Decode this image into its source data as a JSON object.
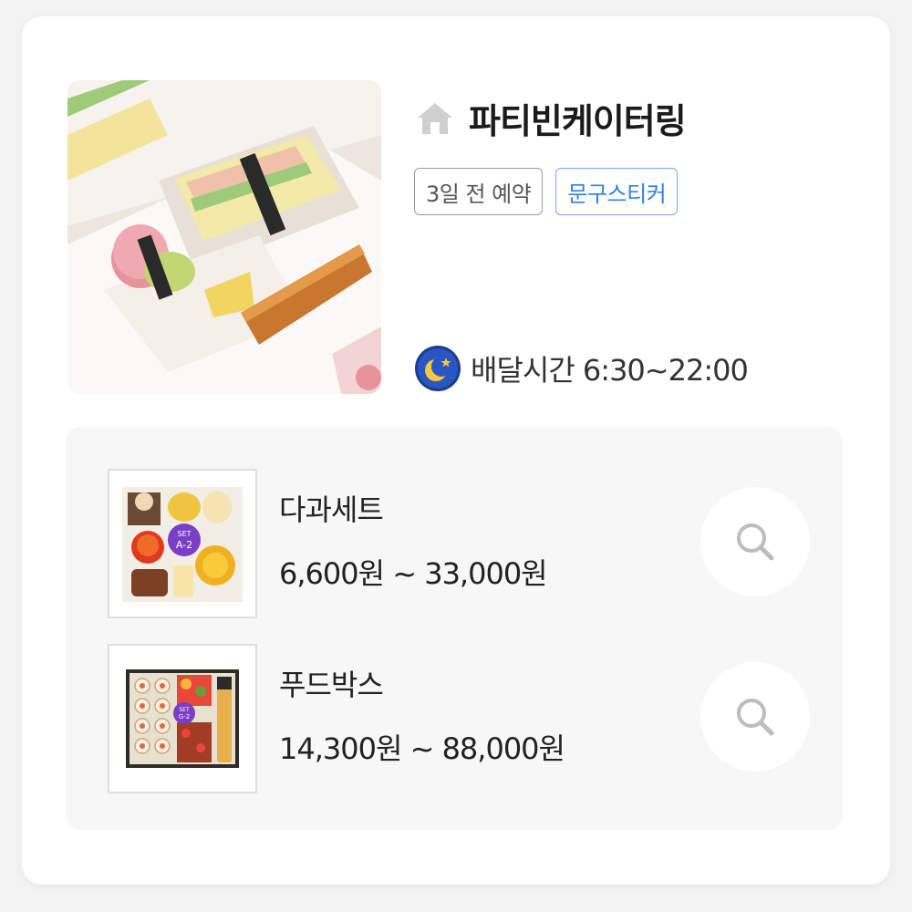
{
  "store": {
    "name": "파티빈케이터링",
    "home_icon": "home-icon"
  },
  "tags": [
    {
      "label": "3일 전 예약",
      "style": "gray"
    },
    {
      "label": "문구스티커",
      "style": "blue"
    }
  ],
  "delivery": {
    "icon": "moon-icon",
    "text": "배달시간 6:30~22:00"
  },
  "menu": [
    {
      "name": "다과세트",
      "price": "6,600원 ~ 33,000원",
      "badge": {
        "line1": "SET",
        "line2": "A-2"
      },
      "action_icon": "search-icon"
    },
    {
      "name": "푸드박스",
      "price": "14,300원 ~ 88,000원",
      "badge": {
        "line1": "SET",
        "line2": "G-2"
      },
      "action_icon": "search-icon"
    }
  ],
  "colors": {
    "tag_blue": "#2f7fe9",
    "tag_gray": "#555555",
    "badge_purple": "#7a3fc4"
  }
}
